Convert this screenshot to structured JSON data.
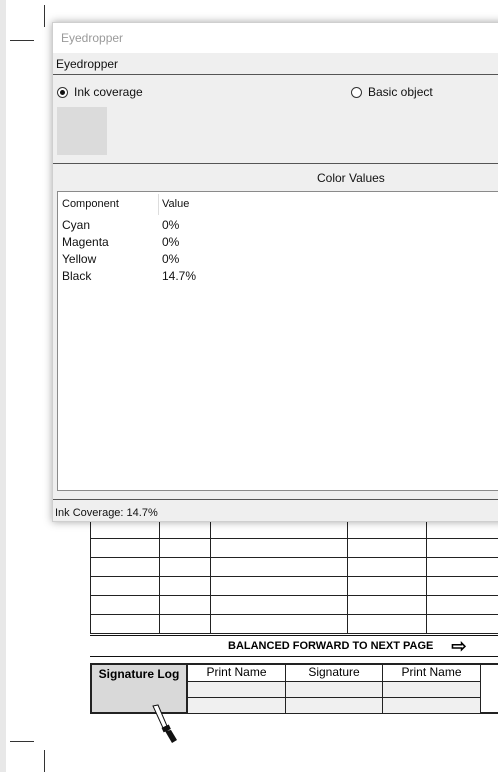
{
  "dialog": {
    "title": "Eyedropper",
    "section_label": "Eyedropper",
    "radio_ink": "Ink coverage",
    "radio_basic": "Basic object",
    "color_values_label": "Color Values",
    "columns": [
      "Component",
      "Value"
    ],
    "rows": [
      {
        "component": "Cyan",
        "value": "0%"
      },
      {
        "component": "Magenta",
        "value": "0%"
      },
      {
        "component": "Yellow",
        "value": "0%"
      },
      {
        "component": "Black",
        "value": "14.7%"
      }
    ],
    "status": "Ink Coverage:  14.7%"
  },
  "document": {
    "balanced_text": "BALANCED FORWARD TO NEXT PAGE",
    "balanced_arrow": "⇨",
    "signature_log_title": "Signature Log",
    "signature_headers": [
      "Print Name",
      "Signature",
      "Print Name"
    ]
  }
}
